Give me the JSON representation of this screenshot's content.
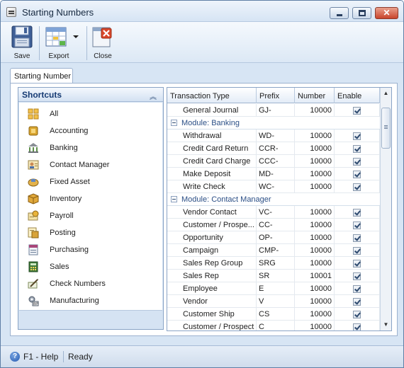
{
  "window": {
    "title": "Starting Numbers"
  },
  "toolbar": {
    "save_label": "Save",
    "export_label": "Export",
    "close_label": "Close"
  },
  "tabs": [
    {
      "label": "Starting Number"
    }
  ],
  "shortcuts": {
    "title": "Shortcuts",
    "items": [
      {
        "label": "All",
        "icon": "grid-icon"
      },
      {
        "label": "Accounting",
        "icon": "ledger-icon"
      },
      {
        "label": "Banking",
        "icon": "bank-icon"
      },
      {
        "label": "Contact Manager",
        "icon": "contact-card-icon"
      },
      {
        "label": "Fixed Asset",
        "icon": "fixed-asset-icon"
      },
      {
        "label": "Inventory",
        "icon": "box-icon"
      },
      {
        "label": "Payroll",
        "icon": "payroll-icon"
      },
      {
        "label": "Posting",
        "icon": "posting-icon"
      },
      {
        "label": "Purchasing",
        "icon": "purchasing-icon"
      },
      {
        "label": "Sales",
        "icon": "sales-icon"
      },
      {
        "label": "Check Numbers",
        "icon": "check-pen-icon"
      },
      {
        "label": "Manufacturing",
        "icon": "manufacturing-icon"
      }
    ]
  },
  "grid": {
    "columns": [
      "Transaction Type",
      "Prefix",
      "Number",
      "Enable"
    ],
    "rows": [
      {
        "kind": "row",
        "type": "General Journal",
        "prefix": "GJ-",
        "number": "10000",
        "enabled": true
      },
      {
        "kind": "group",
        "label": "Module: Banking"
      },
      {
        "kind": "row",
        "type": "Withdrawal",
        "prefix": "WD-",
        "number": "10000",
        "enabled": true
      },
      {
        "kind": "row",
        "type": "Credit Card Return",
        "prefix": "CCR-",
        "number": "10000",
        "enabled": true
      },
      {
        "kind": "row",
        "type": "Credit Card Charge",
        "prefix": "CCC-",
        "number": "10000",
        "enabled": true
      },
      {
        "kind": "row",
        "type": "Make Deposit",
        "prefix": "MD-",
        "number": "10000",
        "enabled": true
      },
      {
        "kind": "row",
        "type": "Write Check",
        "prefix": "WC-",
        "number": "10000",
        "enabled": true
      },
      {
        "kind": "group",
        "label": "Module: Contact Manager"
      },
      {
        "kind": "row",
        "type": "Vendor Contact",
        "prefix": "VC-",
        "number": "10000",
        "enabled": true
      },
      {
        "kind": "row",
        "type": "Customer / Prospe...",
        "prefix": "CC-",
        "number": "10000",
        "enabled": true
      },
      {
        "kind": "row",
        "type": "Opportunity",
        "prefix": "OP-",
        "number": "10000",
        "enabled": true
      },
      {
        "kind": "row",
        "type": "Campaign",
        "prefix": "CMP-",
        "number": "10000",
        "enabled": true
      },
      {
        "kind": "row",
        "type": "Sales Rep Group",
        "prefix": "SRG",
        "number": "10000",
        "enabled": true
      },
      {
        "kind": "row",
        "type": "Sales Rep",
        "prefix": "SR",
        "number": "10001",
        "enabled": true
      },
      {
        "kind": "row",
        "type": "Employee",
        "prefix": "E",
        "number": "10000",
        "enabled": true
      },
      {
        "kind": "row",
        "type": "Vendor",
        "prefix": "V",
        "number": "10000",
        "enabled": true
      },
      {
        "kind": "row",
        "type": "Customer Ship",
        "prefix": "CS",
        "number": "10000",
        "enabled": true
      },
      {
        "kind": "row",
        "type": "Customer / Prospect",
        "prefix": "C",
        "number": "10000",
        "enabled": true
      }
    ]
  },
  "statusbar": {
    "help_label": "F1 - Help",
    "status": "Ready"
  }
}
